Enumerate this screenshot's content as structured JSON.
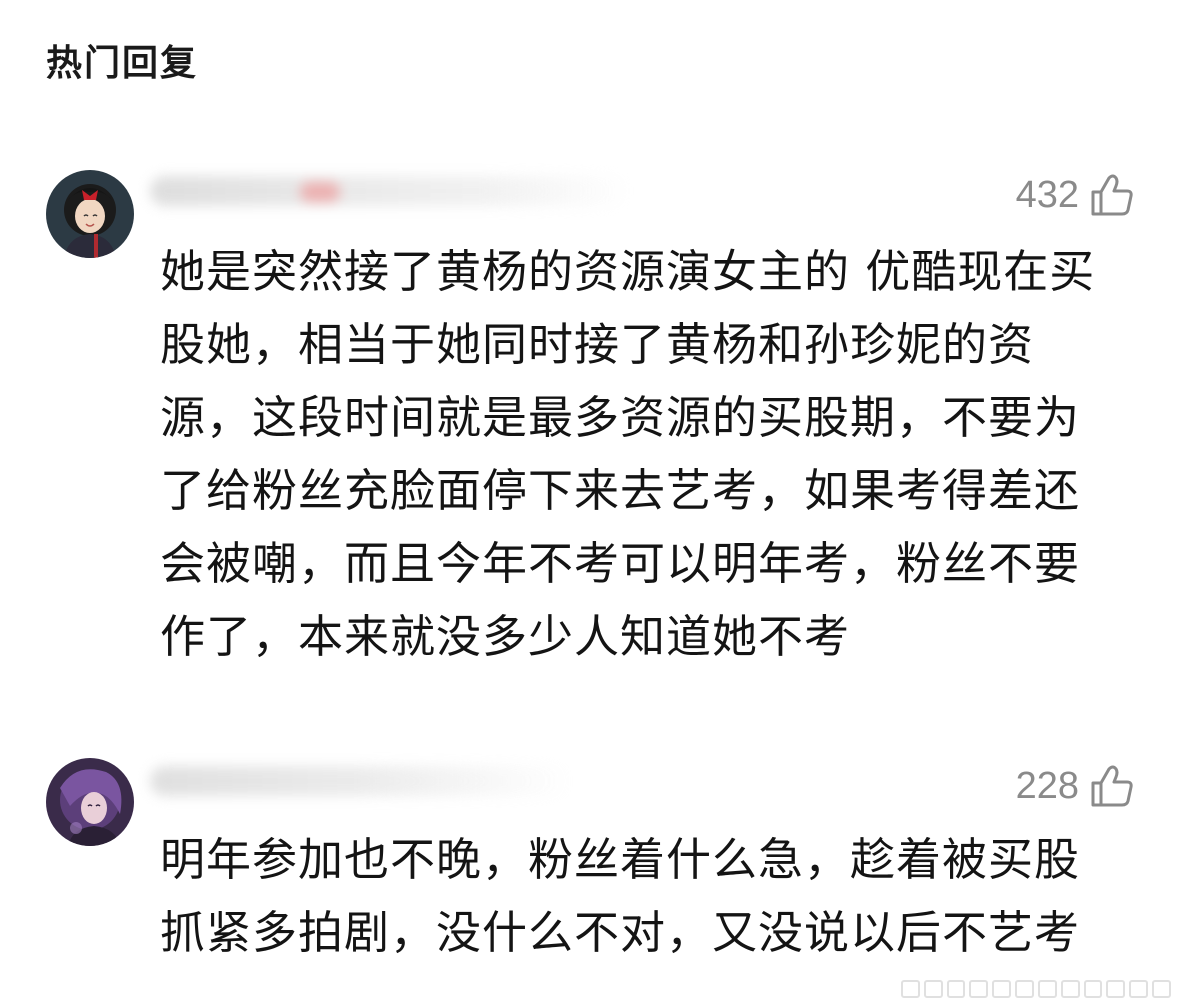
{
  "section": {
    "title": "热门回复"
  },
  "comments": [
    {
      "likes": "432",
      "lines": [
        "她是突然接了黄杨的资源演女主的 优酷现在买",
        "股她，相当于她同时接了黄杨和孙珍妮的资",
        "源，这段时间就是最多资源的买股期，不要为",
        "了给粉丝充脸面停下来去艺考，如果考得差还",
        "会被嘲，而且今年不考可以明年考，粉丝不要",
        "作了，本来就没多少人知道她不考"
      ]
    },
    {
      "likes": "228",
      "lines": [
        "明年参加也不晚，粉丝着什么急，趁着被买股",
        "抓紧多拍剧，没什么不对，又没说以后不艺考"
      ]
    }
  ],
  "colors": {
    "like_gray": "#8a8a8a",
    "text": "#141414"
  },
  "icons": {
    "like": "thumbs-up-icon"
  }
}
